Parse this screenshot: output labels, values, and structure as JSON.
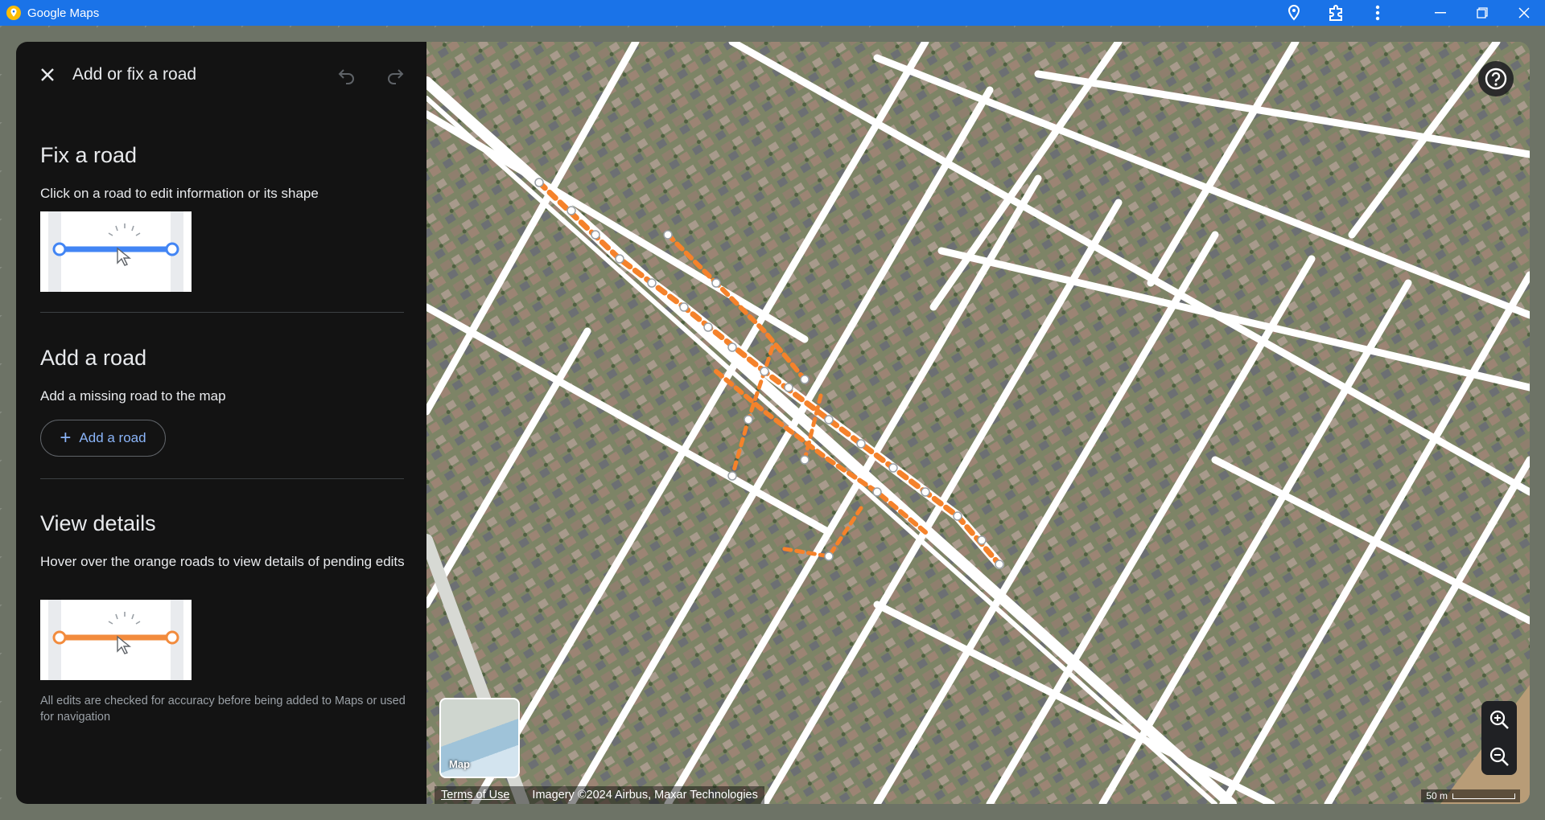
{
  "window": {
    "title": "Google Maps",
    "icons": [
      "maps-pin-icon",
      "location-pin-icon",
      "extension-icon",
      "more-vert-icon",
      "minimize-icon",
      "restore-icon",
      "close-icon"
    ]
  },
  "panel": {
    "title": "Add or fix a road",
    "fix": {
      "heading": "Fix a road",
      "description": "Click on a road to edit information or its shape",
      "accent": "#4285f4"
    },
    "add": {
      "heading": "Add a road",
      "description": "Add a missing road to the map",
      "button_label": "Add a road"
    },
    "details": {
      "heading": "View details",
      "description": "Hover over the orange roads to view details of pending edits",
      "accent": "#f28b3d"
    },
    "footnote": "All edits are checked for accuracy before being added to Maps or used for navigation"
  },
  "map": {
    "layer_toggle_label": "Map",
    "terms": "Terms of Use",
    "imagery": "Imagery ©2024 Airbus, Maxar Technologies",
    "scale": "50 m",
    "pending_road_color": "#f5822b"
  }
}
